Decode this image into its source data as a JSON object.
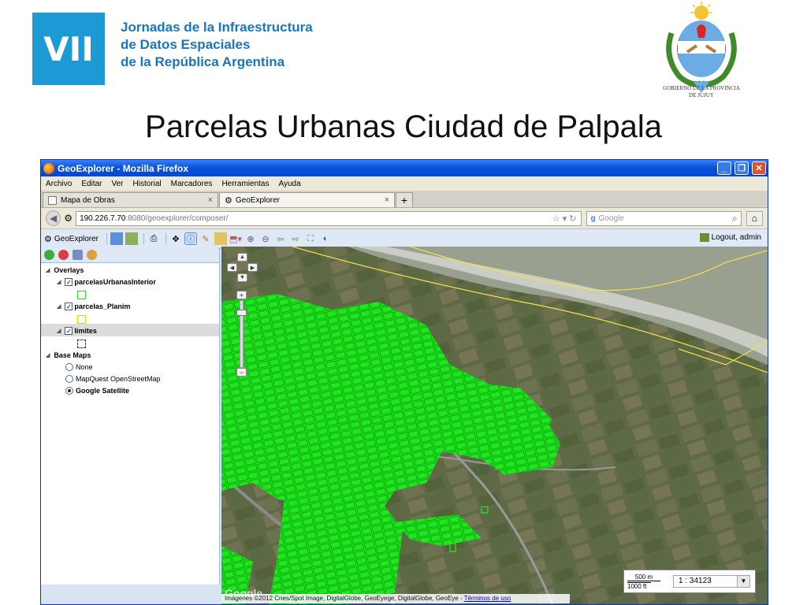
{
  "slide": {
    "badge": "VII",
    "org_lines": [
      "Jornadas de la Infraestructura",
      "de Datos Espaciales",
      "de la República Argentina"
    ],
    "seal_caption": [
      "GOBIERNO DE LA PROVINCIA",
      "DE JUJUY"
    ],
    "title": "Parcelas Urbanas Ciudad de Palpala"
  },
  "window": {
    "title": "GeoExplorer - Mozilla Firefox",
    "menu": [
      "Archivo",
      "Editar",
      "Ver",
      "Historial",
      "Marcadores",
      "Herramientas",
      "Ayuda"
    ],
    "tabs": [
      {
        "label": "Mapa de Obras"
      },
      {
        "label": "GeoExplorer"
      }
    ],
    "new_tab": "+",
    "url_host": "190.226.7.70",
    "url_path": ":8080/geoexplorer/composer/",
    "search_placeholder": "Google"
  },
  "geoexplorer": {
    "app_label": "GeoExplorer",
    "logout_label": "Logout, admin",
    "tree": {
      "overlays_label": "Overlays",
      "layers": [
        {
          "label": "parcelasUrbanasInterior",
          "color": "#33dd33"
        },
        {
          "label": "parcelas_Planim",
          "color": "#e8d000"
        },
        {
          "label": "limites",
          "color": "#333333"
        }
      ],
      "base_maps_label": "Base Maps",
      "base_maps": [
        {
          "label": "None"
        },
        {
          "label": "MapQuest OpenStreetMap"
        },
        {
          "label": "Google Satellite"
        }
      ]
    },
    "map": {
      "scale_top": "500 m",
      "scale_bottom": "1000 ft",
      "scale_ratio": "1 : 34123",
      "google_logo": "Google",
      "attribution": "Imágenes ©2012 Cnes/Spot Image, DigitalGlobe, GeoEye",
      "attribution_2": "ge, DigitalGlobe, GeoEye -",
      "terms_link": "Términos de uso"
    }
  },
  "colors": {
    "brand_blue": "#1d9ad6",
    "parcel_green": "#22ff22",
    "river_yellow": "#f2e34a"
  }
}
